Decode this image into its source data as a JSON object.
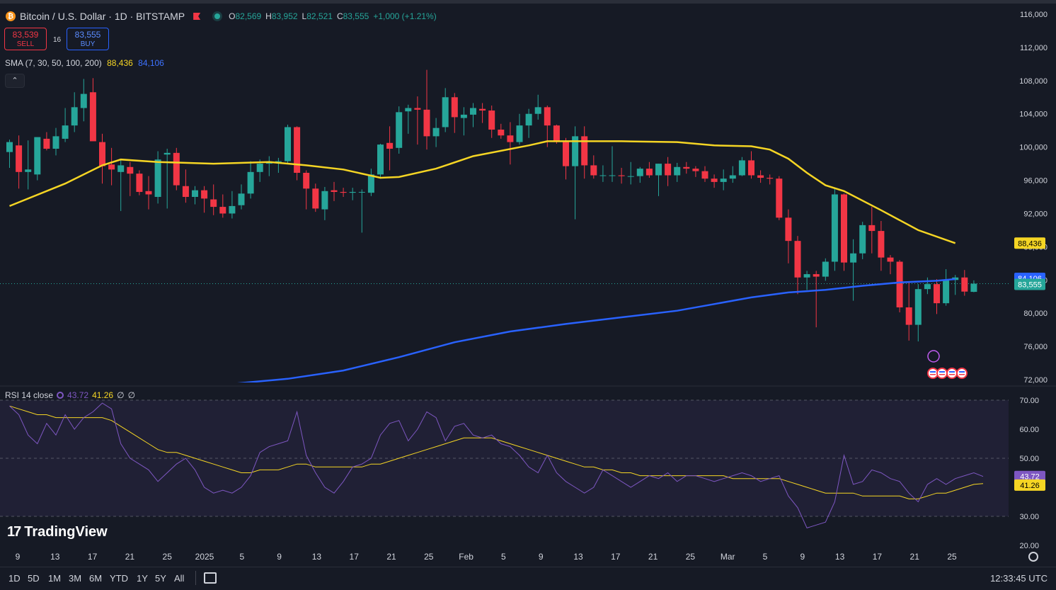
{
  "symbol": {
    "title": "Bitcoin / U.S. Dollar · 1D · BITSTAMP",
    "btc_glyph": "₿"
  },
  "ohlc": {
    "open_label": "O",
    "open": "82,569",
    "high_label": "H",
    "high": "83,952",
    "low_label": "L",
    "low": "82,521",
    "close_label": "C",
    "close": "83,555",
    "change": "+1,000 (+1.21%)"
  },
  "trade": {
    "sell_price": "83,539",
    "sell_label": "SELL",
    "spread": "16",
    "buy_price": "83,555",
    "buy_label": "BUY"
  },
  "sma": {
    "label": "SMA (7, 30, 50, 100, 200)",
    "value1": "88,436",
    "value2": "84,106"
  },
  "collapse_glyph": "⌃",
  "rsi": {
    "label": "RSI 14 close",
    "value1": "43.72",
    "value2": "41.26",
    "na1": "∅",
    "na2": "∅"
  },
  "price_axis": {
    "ticks": [
      "116,000",
      "112,000",
      "108,000",
      "104,000",
      "100,000",
      "96,000",
      "92,000",
      "88,000",
      "84,000",
      "80,000",
      "76,000",
      "72,000"
    ],
    "tick_values": [
      116000,
      112000,
      108000,
      104000,
      100000,
      96000,
      92000,
      88000,
      84000,
      80000,
      76000,
      72000
    ],
    "badges": [
      {
        "text": "88,436",
        "value": 88436,
        "color": "#f5d524",
        "text_color": "#000000"
      },
      {
        "text": "84,106",
        "value": 84106,
        "color": "#2962ff",
        "text_color": "#ffffff"
      },
      {
        "text": "83,555",
        "value": 83555,
        "color": "#26a69a",
        "text_color": "#ffffff"
      }
    ]
  },
  "rsi_axis": {
    "ticks": [
      "70.00",
      "60.00",
      "50.00",
      "40.00",
      "30.00",
      "20.00"
    ],
    "tick_values": [
      70,
      60,
      50,
      40,
      30,
      20
    ],
    "badges": [
      {
        "text": "43.72",
        "value": 43.72,
        "color": "#7e57c2",
        "text_color": "#ffffff"
      },
      {
        "text": "41.26",
        "value": 41.26,
        "color": "#f5d524",
        "text_color": "#000000"
      }
    ]
  },
  "time_axis": [
    "9",
    "13",
    "17",
    "21",
    "25",
    "2025",
    "5",
    "9",
    "13",
    "17",
    "21",
    "25",
    "Feb",
    "5",
    "9",
    "13",
    "17",
    "21",
    "25",
    "Mar",
    "5",
    "9",
    "13",
    "17",
    "21",
    "25"
  ],
  "timeframes": [
    "1D",
    "5D",
    "1M",
    "3M",
    "6M",
    "YTD",
    "1Y",
    "5Y",
    "All"
  ],
  "clock": "12:33:45 UTC",
  "brand": "TradingView",
  "colors": {
    "up": "#26a69a",
    "down": "#f23645",
    "sma_fast": "#f5d524",
    "sma_slow": "#2962ff",
    "rsi": "#7e57c2",
    "rsi_ma": "#f5d524",
    "background": "#161a25"
  },
  "chart_data": {
    "type": "candlestick",
    "symbol": "Bitcoin / U.S. Dollar",
    "interval": "1D",
    "exchange": "BITSTAMP",
    "ylim": [
      71500,
      117000
    ],
    "candles": [
      {
        "o": 99400,
        "h": 100900,
        "l": 97500,
        "c": 100600
      },
      {
        "o": 100200,
        "h": 101400,
        "l": 95000,
        "c": 97000
      },
      {
        "o": 97000,
        "h": 100800,
        "l": 94900,
        "c": 97300
      },
      {
        "o": 96700,
        "h": 100900,
        "l": 96000,
        "c": 101200
      },
      {
        "o": 101000,
        "h": 101800,
        "l": 99600,
        "c": 99800
      },
      {
        "o": 99800,
        "h": 102300,
        "l": 99000,
        "c": 101300
      },
      {
        "o": 101000,
        "h": 104700,
        "l": 100600,
        "c": 102600
      },
      {
        "o": 102600,
        "h": 106600,
        "l": 101800,
        "c": 104800
      },
      {
        "o": 104700,
        "h": 108200,
        "l": 103100,
        "c": 106400
      },
      {
        "o": 106600,
        "h": 108300,
        "l": 100800,
        "c": 100700
      },
      {
        "o": 100600,
        "h": 101600,
        "l": 95600,
        "c": 97700
      },
      {
        "o": 97900,
        "h": 99900,
        "l": 95400,
        "c": 97300
      },
      {
        "o": 97000,
        "h": 98500,
        "l": 92300,
        "c": 97800
      },
      {
        "o": 97600,
        "h": 98200,
        "l": 94100,
        "c": 96800
      },
      {
        "o": 96800,
        "h": 97200,
        "l": 94200,
        "c": 94600
      },
      {
        "o": 94700,
        "h": 96500,
        "l": 92500,
        "c": 94300
      },
      {
        "o": 94000,
        "h": 99500,
        "l": 93200,
        "c": 98500
      },
      {
        "o": 99100,
        "h": 99800,
        "l": 92600,
        "c": 99300
      },
      {
        "o": 99300,
        "h": 99900,
        "l": 94800,
        "c": 95400
      },
      {
        "o": 95300,
        "h": 97300,
        "l": 93300,
        "c": 94000
      },
      {
        "o": 94000,
        "h": 95300,
        "l": 93100,
        "c": 94800
      },
      {
        "o": 94800,
        "h": 95300,
        "l": 92100,
        "c": 93800
      },
      {
        "o": 93700,
        "h": 95500,
        "l": 91800,
        "c": 92800
      },
      {
        "o": 92800,
        "h": 94300,
        "l": 91500,
        "c": 92000
      },
      {
        "o": 92000,
        "h": 94700,
        "l": 91400,
        "c": 92900
      },
      {
        "o": 93000,
        "h": 95500,
        "l": 92500,
        "c": 94400
      },
      {
        "o": 94400,
        "h": 98300,
        "l": 93800,
        "c": 97000
      },
      {
        "o": 97000,
        "h": 98500,
        "l": 95800,
        "c": 98000
      },
      {
        "o": 98000,
        "h": 98900,
        "l": 96500,
        "c": 98200
      },
      {
        "o": 98200,
        "h": 98700,
        "l": 96900,
        "c": 98300
      },
      {
        "o": 98300,
        "h": 102700,
        "l": 98000,
        "c": 102400
      },
      {
        "o": 102400,
        "h": 102500,
        "l": 96000,
        "c": 96900
      },
      {
        "o": 96900,
        "h": 97200,
        "l": 92500,
        "c": 95000
      },
      {
        "o": 95000,
        "h": 95600,
        "l": 92200,
        "c": 92600
      },
      {
        "o": 92500,
        "h": 95200,
        "l": 91200,
        "c": 94700
      },
      {
        "o": 94800,
        "h": 95800,
        "l": 93500,
        "c": 94600
      },
      {
        "o": 94600,
        "h": 95100,
        "l": 94000,
        "c": 94500
      },
      {
        "o": 94500,
        "h": 95100,
        "l": 93600,
        "c": 94600
      },
      {
        "o": 94600,
        "h": 94900,
        "l": 89700,
        "c": 94600
      },
      {
        "o": 94500,
        "h": 97400,
        "l": 94100,
        "c": 96700
      },
      {
        "o": 96700,
        "h": 100400,
        "l": 96200,
        "c": 100300
      },
      {
        "o": 100500,
        "h": 102500,
        "l": 97200,
        "c": 99800
      },
      {
        "o": 99900,
        "h": 104900,
        "l": 99200,
        "c": 104200
      },
      {
        "o": 104300,
        "h": 105100,
        "l": 101600,
        "c": 104700
      },
      {
        "o": 104700,
        "h": 106100,
        "l": 100300,
        "c": 104500
      },
      {
        "o": 104500,
        "h": 109300,
        "l": 99700,
        "c": 101300
      },
      {
        "o": 101300,
        "h": 103500,
        "l": 100000,
        "c": 102300
      },
      {
        "o": 102400,
        "h": 107100,
        "l": 101800,
        "c": 106000
      },
      {
        "o": 106000,
        "h": 106500,
        "l": 101700,
        "c": 103600
      },
      {
        "o": 103500,
        "h": 104800,
        "l": 101400,
        "c": 103900
      },
      {
        "o": 103900,
        "h": 105300,
        "l": 102400,
        "c": 104700
      },
      {
        "o": 104600,
        "h": 105300,
        "l": 102900,
        "c": 104400
      },
      {
        "o": 104400,
        "h": 105000,
        "l": 101100,
        "c": 102100
      },
      {
        "o": 102100,
        "h": 102800,
        "l": 101000,
        "c": 101400
      },
      {
        "o": 101400,
        "h": 103000,
        "l": 97900,
        "c": 100600
      },
      {
        "o": 100600,
        "h": 104000,
        "l": 100300,
        "c": 102600
      },
      {
        "o": 102600,
        "h": 104600,
        "l": 101100,
        "c": 104000
      },
      {
        "o": 104000,
        "h": 106300,
        "l": 103300,
        "c": 104800
      },
      {
        "o": 104800,
        "h": 105000,
        "l": 100000,
        "c": 102600
      },
      {
        "o": 102600,
        "h": 102700,
        "l": 100400,
        "c": 100600
      },
      {
        "o": 100600,
        "h": 101100,
        "l": 96100,
        "c": 97700
      },
      {
        "o": 97700,
        "h": 102500,
        "l": 91300,
        "c": 101300
      },
      {
        "o": 101300,
        "h": 102500,
        "l": 96200,
        "c": 97800
      },
      {
        "o": 97800,
        "h": 99000,
        "l": 96200,
        "c": 96600
      },
      {
        "o": 96600,
        "h": 97800,
        "l": 95800,
        "c": 96600
      },
      {
        "o": 96600,
        "h": 100100,
        "l": 95800,
        "c": 96600
      },
      {
        "o": 96600,
        "h": 97500,
        "l": 95600,
        "c": 96500
      },
      {
        "o": 96500,
        "h": 98200,
        "l": 95500,
        "c": 96500
      },
      {
        "o": 96500,
        "h": 97600,
        "l": 95700,
        "c": 97400
      },
      {
        "o": 97400,
        "h": 98200,
        "l": 96300,
        "c": 96600
      },
      {
        "o": 96600,
        "h": 98000,
        "l": 94100,
        "c": 98000
      },
      {
        "o": 98000,
        "h": 98800,
        "l": 95300,
        "c": 96600
      },
      {
        "o": 96600,
        "h": 98100,
        "l": 95800,
        "c": 97600
      },
      {
        "o": 97600,
        "h": 98200,
        "l": 96800,
        "c": 97400
      },
      {
        "o": 97400,
        "h": 97700,
        "l": 96400,
        "c": 97100
      },
      {
        "o": 97100,
        "h": 97700,
        "l": 95800,
        "c": 96200
      },
      {
        "o": 96200,
        "h": 96700,
        "l": 95100,
        "c": 95800
      },
      {
        "o": 95800,
        "h": 97300,
        "l": 94800,
        "c": 96200
      },
      {
        "o": 96200,
        "h": 97700,
        "l": 95700,
        "c": 96600
      },
      {
        "o": 96600,
        "h": 98800,
        "l": 96500,
        "c": 98400
      },
      {
        "o": 98400,
        "h": 99500,
        "l": 96200,
        "c": 96600
      },
      {
        "o": 96600,
        "h": 97200,
        "l": 95700,
        "c": 96300
      },
      {
        "o": 96300,
        "h": 96700,
        "l": 95500,
        "c": 96200
      },
      {
        "o": 96200,
        "h": 96500,
        "l": 91200,
        "c": 91500
      },
      {
        "o": 91500,
        "h": 92500,
        "l": 86000,
        "c": 88700
      },
      {
        "o": 88700,
        "h": 89300,
        "l": 82300,
        "c": 84300
      },
      {
        "o": 84300,
        "h": 85100,
        "l": 82800,
        "c": 84700
      },
      {
        "o": 84700,
        "h": 85100,
        "l": 78300,
        "c": 84400
      },
      {
        "o": 84400,
        "h": 86600,
        "l": 83900,
        "c": 86200
      },
      {
        "o": 86200,
        "h": 95000,
        "l": 85100,
        "c": 94300
      },
      {
        "o": 94300,
        "h": 94400,
        "l": 85100,
        "c": 86100
      },
      {
        "o": 86100,
        "h": 88900,
        "l": 81500,
        "c": 87200
      },
      {
        "o": 87200,
        "h": 91000,
        "l": 86500,
        "c": 90600
      },
      {
        "o": 90600,
        "h": 92800,
        "l": 87200,
        "c": 89900
      },
      {
        "o": 89900,
        "h": 91100,
        "l": 85100,
        "c": 86700
      },
      {
        "o": 86700,
        "h": 87000,
        "l": 84700,
        "c": 86200
      },
      {
        "o": 86200,
        "h": 86400,
        "l": 80100,
        "c": 80700
      },
      {
        "o": 80700,
        "h": 83800,
        "l": 76700,
        "c": 78600
      },
      {
        "o": 78600,
        "h": 83500,
        "l": 76600,
        "c": 82900
      },
      {
        "o": 82900,
        "h": 84300,
        "l": 82300,
        "c": 83500
      },
      {
        "o": 83500,
        "h": 84100,
        "l": 79900,
        "c": 81200
      },
      {
        "o": 81200,
        "h": 85300,
        "l": 80900,
        "c": 84000
      },
      {
        "o": 84000,
        "h": 84600,
        "l": 82200,
        "c": 84300
      },
      {
        "o": 84300,
        "h": 85200,
        "l": 82100,
        "c": 82600
      },
      {
        "o": 82569,
        "h": 83952,
        "l": 82521,
        "c": 83555
      }
    ],
    "sma_fast": {
      "name": "SMA (7, 30, 50, 100, 200)",
      "last": 88436,
      "points": [
        [
          0,
          92900
        ],
        [
          6,
          95600
        ],
        [
          10,
          97800
        ],
        [
          12,
          98500
        ],
        [
          16,
          98200
        ],
        [
          22,
          98000
        ],
        [
          28,
          98200
        ],
        [
          32,
          97800
        ],
        [
          36,
          97300
        ],
        [
          40,
          96300
        ],
        [
          42,
          96400
        ],
        [
          46,
          97400
        ],
        [
          50,
          98900
        ],
        [
          56,
          100200
        ],
        [
          58,
          100700
        ],
        [
          62,
          100700
        ],
        [
          66,
          100700
        ],
        [
          72,
          100600
        ],
        [
          76,
          100200
        ],
        [
          80,
          100100
        ],
        [
          82,
          99700
        ],
        [
          84,
          98600
        ],
        [
          86,
          96900
        ],
        [
          88,
          95400
        ],
        [
          90,
          94700
        ],
        [
          94,
          92400
        ],
        [
          98,
          90000
        ],
        [
          102,
          88436
        ]
      ]
    },
    "sma_slow": {
      "last": 84106,
      "points": [
        [
          24,
          71500
        ],
        [
          30,
          72100
        ],
        [
          36,
          73100
        ],
        [
          42,
          74700
        ],
        [
          48,
          76500
        ],
        [
          54,
          77800
        ],
        [
          60,
          78700
        ],
        [
          66,
          79500
        ],
        [
          72,
          80300
        ],
        [
          76,
          81100
        ],
        [
          80,
          81900
        ],
        [
          84,
          82500
        ],
        [
          88,
          82800
        ],
        [
          92,
          83300
        ],
        [
          96,
          83700
        ],
        [
          100,
          83900
        ],
        [
          102,
          84106
        ]
      ]
    },
    "rsi_series": [
      68,
      65,
      58,
      55,
      62,
      58,
      65,
      60,
      64,
      66,
      69,
      67,
      55,
      50,
      48,
      46,
      42,
      45,
      48,
      50,
      46,
      40,
      38,
      39,
      38,
      40,
      44,
      52,
      54,
      55,
      56,
      66,
      51,
      45,
      40,
      38,
      42,
      47,
      48,
      50,
      58,
      62,
      63,
      56,
      60,
      66,
      64,
      56,
      61,
      62,
      58,
      57,
      58,
      55,
      54,
      51,
      47,
      45,
      51,
      45,
      42,
      40,
      38,
      40,
      46,
      44,
      42,
      40,
      42,
      44,
      43,
      45,
      42,
      44,
      44,
      43,
      42,
      43,
      44,
      45,
      44,
      42,
      43,
      44,
      37,
      33,
      26,
      27,
      28,
      35,
      51,
      41,
      42,
      46,
      45,
      43,
      42,
      38,
      35,
      41,
      43,
      41,
      43,
      44,
      45,
      43.72
    ],
    "rsi_ma_series": [
      68,
      67,
      66,
      65,
      65,
      64,
      64,
      64,
      64,
      64,
      64,
      63,
      61,
      59,
      57,
      55,
      53,
      52,
      52,
      51,
      50,
      49,
      48,
      47,
      46,
      45,
      45,
      46,
      46,
      46,
      47,
      48,
      48,
      47,
      47,
      47,
      47,
      47,
      47,
      48,
      48,
      49,
      50,
      51,
      52,
      53,
      54,
      55,
      56,
      57,
      57,
      57,
      57,
      56,
      55,
      54,
      53,
      52,
      51,
      50,
      49,
      48,
      47,
      47,
      46,
      46,
      45,
      45,
      44,
      44,
      44,
      44,
      44,
      44,
      44,
      44,
      44,
      44,
      43,
      43,
      43,
      43,
      43,
      43,
      42,
      41,
      40,
      39,
      38,
      38,
      38,
      38,
      37,
      37,
      37,
      37,
      37,
      36,
      36,
      37,
      38,
      38,
      39,
      40,
      41,
      41.26
    ],
    "rsi_ylim": [
      20,
      72
    ],
    "rsi_levels": [
      70,
      50,
      30
    ]
  }
}
